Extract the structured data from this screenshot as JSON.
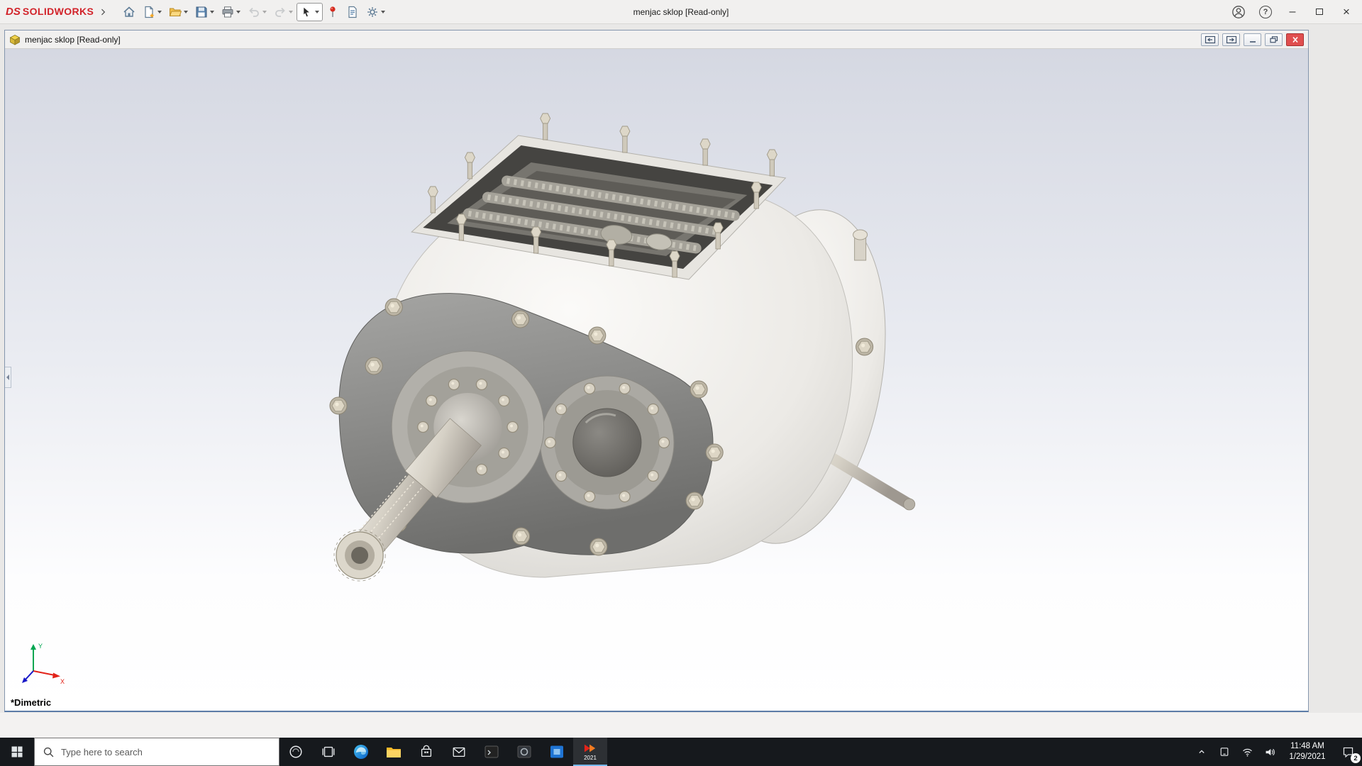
{
  "app_titlebar": {
    "brand_prefix": "DS",
    "brand": "SOLIDWORKS",
    "title": "menjac sklop [Read-only]"
  },
  "glyphs": {
    "help": "?",
    "minimize": "–",
    "close": "×"
  },
  "document_window": {
    "title": "menjac sklop [Read-only]",
    "view_label": "*Dimetric",
    "triad": {
      "x_label": "X",
      "y_label": "Y"
    }
  },
  "taskbar": {
    "search_placeholder": "Type here to search",
    "solidworks_year": "2021",
    "clock_time": "11:48 AM",
    "clock_date": "1/29/2021",
    "notification_count": "2"
  },
  "colors": {
    "brand_red": "#d2232a",
    "viewport_gradient_top": "#d5d8e2",
    "viewport_gradient_bottom": "#ffffff",
    "taskbar_bg": "#16191d",
    "doc_close_red": "#e04f4f",
    "axis_x": "#e2231a",
    "axis_y": "#00a651",
    "axis_z": "#1616c8"
  }
}
